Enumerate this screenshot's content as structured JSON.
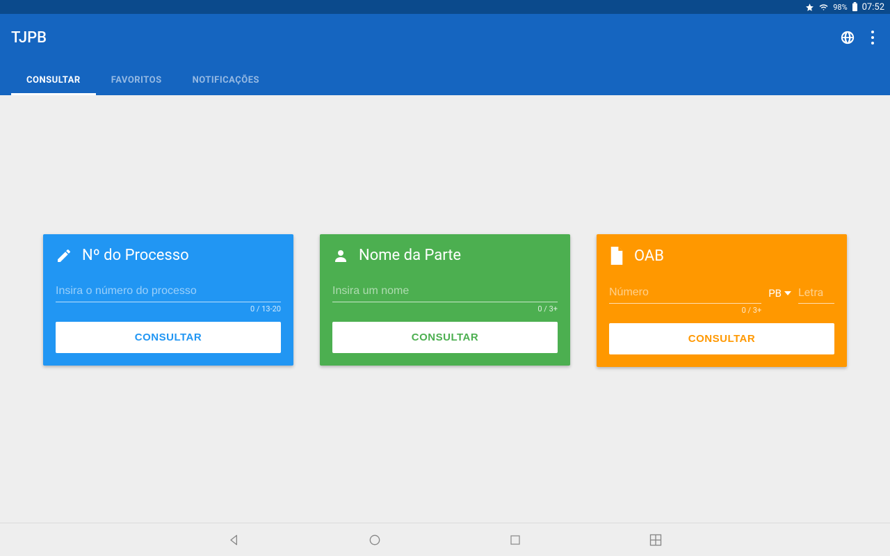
{
  "status": {
    "battery_pct": "98%",
    "time": "07:52"
  },
  "app": {
    "title": "TJPB"
  },
  "tabs": [
    {
      "label": "CONSULTAR",
      "active": true
    },
    {
      "label": "FAVORITOS",
      "active": false
    },
    {
      "label": "NOTIFICAÇÕES",
      "active": false
    }
  ],
  "cards": {
    "processo": {
      "title": "Nº do Processo",
      "placeholder": "Insira o número do processo",
      "counter": "0 / 13-20",
      "button": "CONSULTAR"
    },
    "parte": {
      "title": "Nome da Parte",
      "placeholder": "Insira um nome",
      "counter": "0 / 3+",
      "button": "CONSULTAR"
    },
    "oab": {
      "title": "OAB",
      "numero_placeholder": "Número",
      "numero_counter": "0 / 3+",
      "uf_selected": "PB",
      "letra_placeholder": "Letra",
      "button": "CONSULTAR"
    }
  }
}
